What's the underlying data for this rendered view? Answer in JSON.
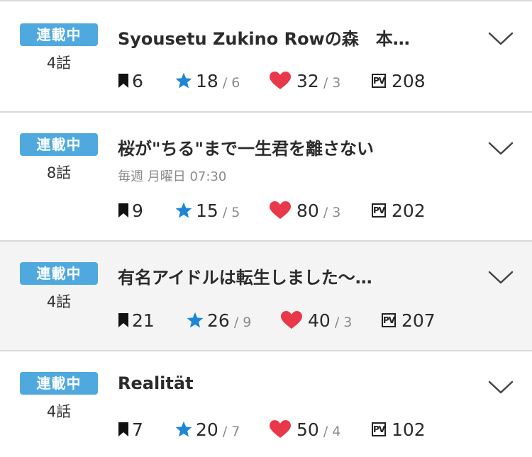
{
  "works": [
    {
      "status": "連載中",
      "episodes": "4話",
      "title": "Syousetu Zukino Rowの森　本…",
      "schedule": "",
      "bookmarks": "6",
      "stars": "18",
      "stars_sub": "/ 6",
      "hearts": "32",
      "hearts_sub": "/ 3",
      "pv": "208"
    },
    {
      "status": "連載中",
      "episodes": "8話",
      "title": "桜が\"ちる\"まで一生君を離さない",
      "schedule": "毎週 月曜日 07:30",
      "bookmarks": "9",
      "stars": "15",
      "stars_sub": "/ 5",
      "hearts": "80",
      "hearts_sub": "/ 3",
      "pv": "202"
    },
    {
      "status": "連載中",
      "episodes": "4話",
      "title": "有名アイドルは転生しました〜…",
      "schedule": "",
      "bookmarks": "21",
      "stars": "26",
      "stars_sub": "/ 9",
      "hearts": "40",
      "hearts_sub": "/ 3",
      "pv": "207"
    },
    {
      "status": "連載中",
      "episodes": "4話",
      "title": "Realität",
      "schedule": "",
      "bookmarks": "7",
      "stars": "20",
      "stars_sub": "/ 7",
      "hearts": "50",
      "hearts_sub": "/ 4",
      "pv": "102"
    }
  ],
  "icons": {
    "bookmark": "bookmark-icon",
    "star": "star-icon",
    "heart": "heart-icon",
    "pv": "pv-icon",
    "expand": "chevron-down-icon"
  },
  "pv_icon_text": "PV",
  "colors": {
    "badge": "#4fa9df",
    "star": "#1e86d4",
    "heart": "#e8384a",
    "divider": "#d9d9d9",
    "highlight": "#f4f4f4"
  }
}
